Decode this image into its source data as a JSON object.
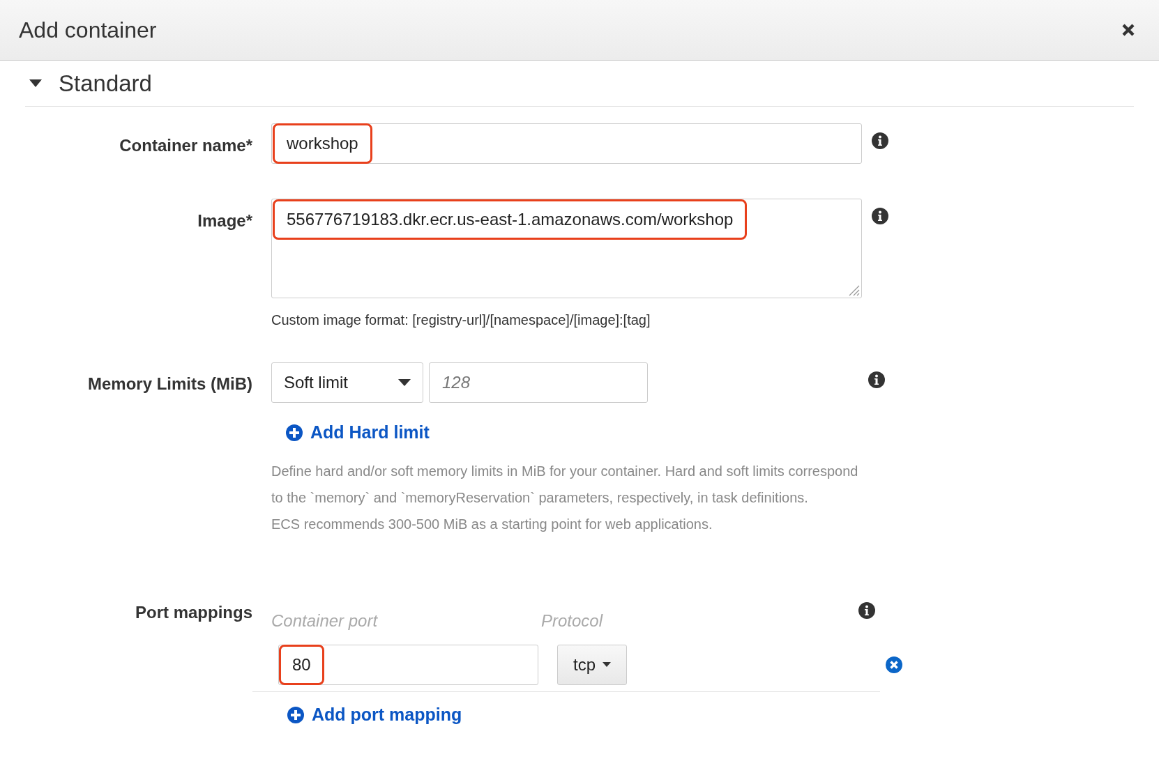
{
  "dialog": {
    "title": "Add container"
  },
  "section": {
    "title": "Standard",
    "expanded": true
  },
  "fields": [
    {
      "kind": "text",
      "label": "Container name*",
      "value": "workshop",
      "highlighted": true
    },
    {
      "kind": "textarea",
      "label": "Image*",
      "value": "556776719183.dkr.ecr.us-east-1.amazonaws.com/workshop",
      "highlighted": true,
      "help": "Custom image format: [registry-url]/[namespace]/[image]:[tag]"
    }
  ],
  "memory": {
    "label": "Memory Limits (MiB)",
    "select": "Soft limit",
    "placeholder": "128",
    "add_link": "Add Hard limit",
    "help": [
      "Define hard and/or soft memory limits in MiB for your container. Hard and soft limits correspond to the `memory` and `memoryReservation` parameters, respectively, in task definitions.",
      "ECS recommends 300-500 MiB as a starting point for web applications."
    ]
  },
  "ports": {
    "label": "Port mappings",
    "columns": [
      "Container port",
      "Protocol"
    ],
    "rows": [
      {
        "port": "80",
        "highlighted": true,
        "protocol": "tcp"
      }
    ],
    "add_link": "Add port mapping"
  }
}
